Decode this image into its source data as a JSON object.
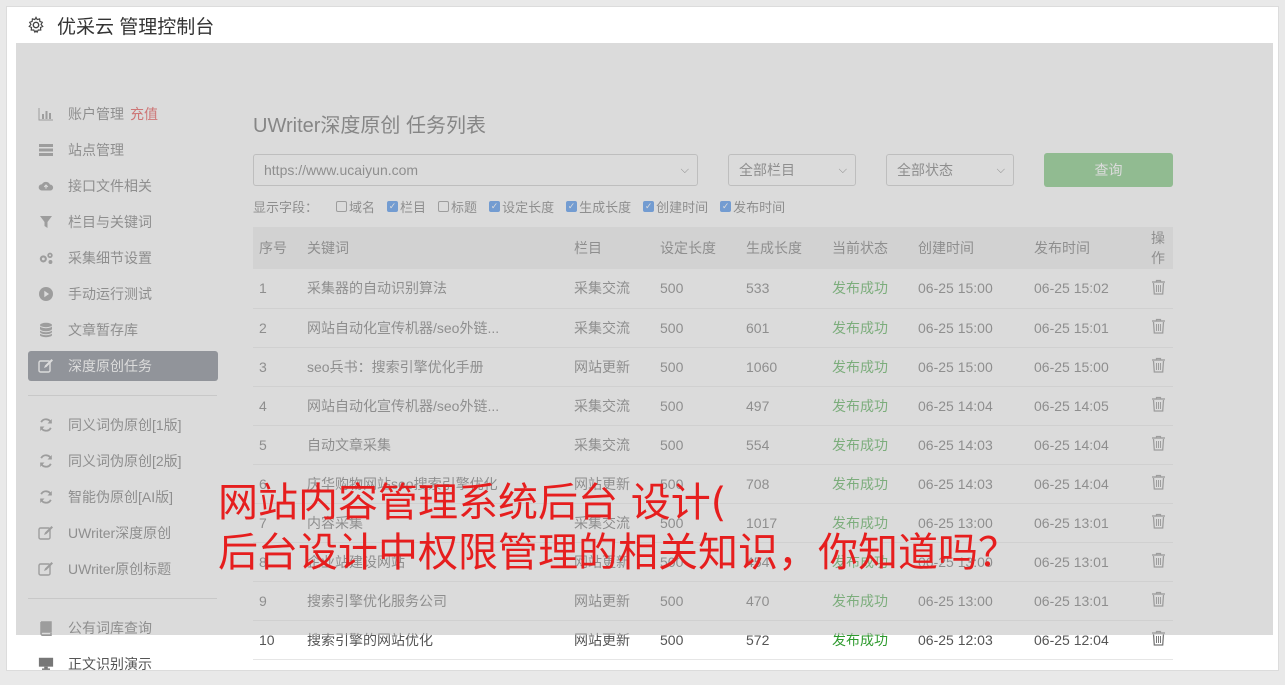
{
  "app": {
    "title": "优采云 管理控制台"
  },
  "sidebar": {
    "group1": [
      {
        "label": "账户管理",
        "extra": "充值",
        "icon": "bar-chart-icon"
      },
      {
        "label": "站点管理",
        "icon": "server-icon"
      },
      {
        "label": "接口文件相关",
        "icon": "cloud-upload-icon"
      },
      {
        "label": "栏目与关键词",
        "icon": "filter-icon"
      },
      {
        "label": "采集细节设置",
        "icon": "gears-icon"
      },
      {
        "label": "手动运行测试",
        "icon": "play-icon"
      },
      {
        "label": "文章暂存库",
        "icon": "database-icon"
      },
      {
        "label": "深度原创任务",
        "icon": "edit-icon",
        "active": true
      }
    ],
    "group2": [
      {
        "label": "同义词伪原创[1版]",
        "icon": "refresh-icon"
      },
      {
        "label": "同义词伪原创[2版]",
        "icon": "refresh-icon"
      },
      {
        "label": "智能伪原创[AI版]",
        "icon": "refresh-icon"
      },
      {
        "label": "UWriter深度原创",
        "icon": "edit-icon"
      },
      {
        "label": "UWriter原创标题",
        "icon": "edit-icon"
      }
    ],
    "group3": [
      {
        "label": "公有词库查询",
        "icon": "book-icon"
      },
      {
        "label": "正文识别演示",
        "icon": "monitor-icon"
      }
    ]
  },
  "main": {
    "title": "UWriter深度原创 任务列表",
    "site_select": "https://www.ucaiyun.com",
    "column_select": "全部栏目",
    "status_select": "全部状态",
    "query_label": "查询",
    "fields_label": "显示字段：",
    "fields": [
      {
        "label": "域名",
        "checked": false
      },
      {
        "label": "栏目",
        "checked": true
      },
      {
        "label": "标题",
        "checked": false
      },
      {
        "label": "设定长度",
        "checked": true
      },
      {
        "label": "生成长度",
        "checked": true
      },
      {
        "label": "创建时间",
        "checked": true
      },
      {
        "label": "发布时间",
        "checked": true
      }
    ],
    "columns": [
      "序号",
      "关键词",
      "栏目",
      "设定长度",
      "生成长度",
      "当前状态",
      "创建时间",
      "发布时间",
      "操作"
    ],
    "rows": [
      [
        "1",
        "采集器的自动识别算法",
        "采集交流",
        "500",
        "533",
        "发布成功",
        "06-25 15:00",
        "06-25 15:02"
      ],
      [
        "2",
        "网站自动化宣传机器/seo外链...",
        "采集交流",
        "500",
        "601",
        "发布成功",
        "06-25 15:00",
        "06-25 15:01"
      ],
      [
        "3",
        "seo兵书：搜索引擎优化手册",
        "网站更新",
        "500",
        "1060",
        "发布成功",
        "06-25 15:00",
        "06-25 15:00"
      ],
      [
        "4",
        "网站自动化宣传机器/seo外链...",
        "采集交流",
        "500",
        "497",
        "发布成功",
        "06-25 14:04",
        "06-25 14:05"
      ],
      [
        "5",
        "自动文章采集",
        "采集交流",
        "500",
        "554",
        "发布成功",
        "06-25 14:03",
        "06-25 14:04"
      ],
      [
        "6",
        "庆华购物网站seo搜索引擎优化",
        "网站更新",
        "500",
        "708",
        "发布成功",
        "06-25 14:03",
        "06-25 14:04"
      ],
      [
        "7",
        "内容采集",
        "采集交流",
        "500",
        "1017",
        "发布成功",
        "06-25 13:00",
        "06-25 13:01"
      ],
      [
        "8",
        "企业站建设网站",
        "网站更新",
        "500",
        "454",
        "发布成功",
        "06-25 13:00",
        "06-25 13:01"
      ],
      [
        "9",
        "搜索引擎优化服务公司",
        "网站更新",
        "500",
        "470",
        "发布成功",
        "06-25 13:00",
        "06-25 13:01"
      ],
      [
        "10",
        "搜索引擎的网站优化",
        "网站更新",
        "500",
        "572",
        "发布成功",
        "06-25 12:03",
        "06-25 12:04"
      ]
    ]
  },
  "overlay": {
    "line1": "网站内容管理系统后台 设计(",
    "line2": "后台设计中权限管理的相关知识，你知道吗？"
  },
  "colors": {
    "success": "#2e9a2e",
    "primary_button": "#5cb85c",
    "active_nav": "#5c6270",
    "overlay_text": "#e61e1e"
  }
}
